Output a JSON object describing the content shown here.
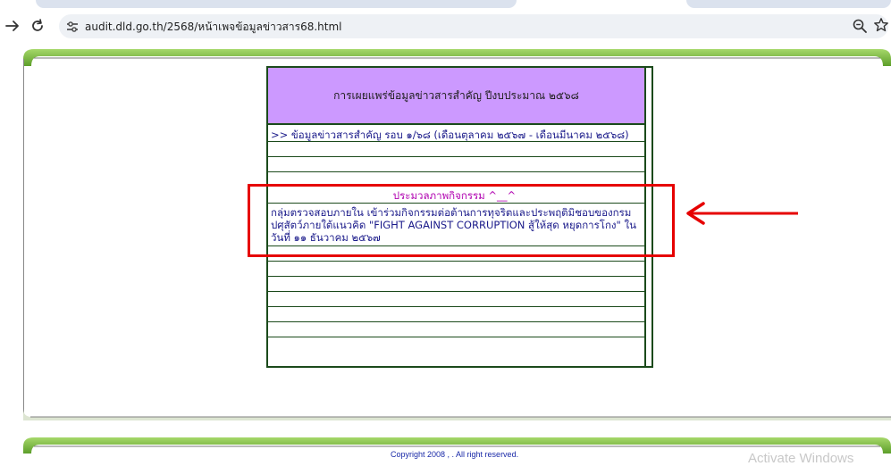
{
  "browser": {
    "url": "audit.dld.go.th/2568/หน้าเพจข้อมูลข่าวสาร68.html",
    "icons": [
      "back-arrow-icon",
      "reload-icon",
      "site-info-icon",
      "zoom-icon",
      "bookmark-star-icon"
    ]
  },
  "table": {
    "header": "การเผยแพร่ข้อมูลข่าวสารสำคัญ ปีงบประมาณ ๒๕๖๘",
    "round_link": ">> ข้อมูลข่าวสารสำคัญ รอบ ๑/๖๘ (เดือนตุลาคม ๒๕๖๗ - เดือนมีนาคม ๒๕๖๘)",
    "activity_title": "ประมวลภาพกิจกรรม ^__^",
    "activity_desc": "กลุ่มตรวจสอบภายใน เข้าร่วมกิจกรรมต่อต้านการทุจริตและประพฤติมิชอบของกรมปศุสัตว์ภายใต้แนวคิด \"FIGHT AGAINST CORRUPTION สู้ให้สุด หยุดการโกง\"  ในวันที่ ๑๑ ธันวาคม ๒๕๖๗"
  },
  "footer": {
    "copyright": "Copyright 2008 , . All right reserved.",
    "watermark": "Activate Windows"
  },
  "colors": {
    "header_bg": "#cc99ff",
    "table_border": "#1b4a1b",
    "link_text": "#1a1a8a",
    "activity_title": "#b000b0",
    "annotation": "#e60000",
    "frame_green": "#79b83a"
  }
}
